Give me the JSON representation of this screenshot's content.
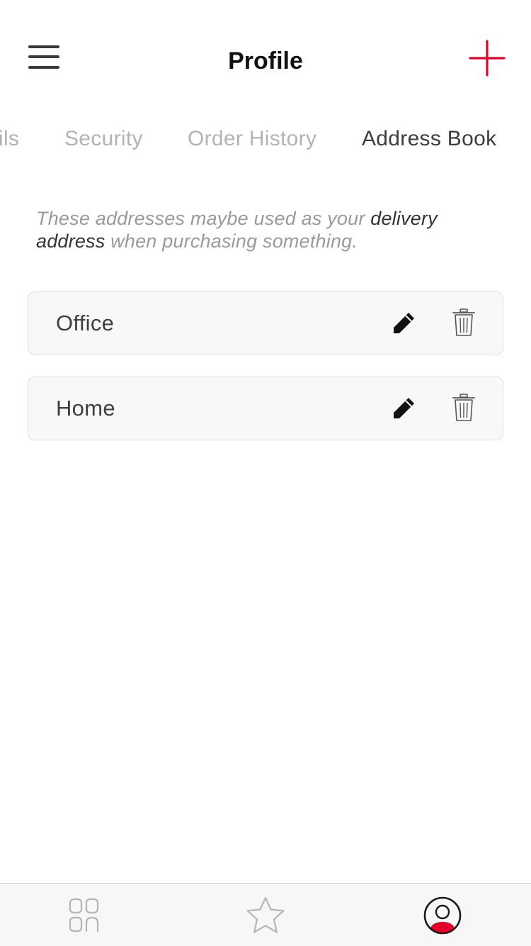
{
  "header": {
    "title": "Profile",
    "menu_icon": "hamburger-menu-icon",
    "add_icon": "plus-icon"
  },
  "tabs": [
    {
      "label": "Details",
      "visible_text": "ils",
      "active": false
    },
    {
      "label": "Security",
      "active": false
    },
    {
      "label": "Order History",
      "active": false
    },
    {
      "label": "Address Book",
      "active": true
    }
  ],
  "description": {
    "part1": "These addresses maybe used as your ",
    "emphasis": "delivery address",
    "part2": " when purchasing something."
  },
  "addresses": [
    {
      "label": "Office",
      "edit_icon": "pencil-icon",
      "delete_icon": "trash-icon"
    },
    {
      "label": "Home",
      "edit_icon": "pencil-icon",
      "delete_icon": "trash-icon"
    }
  ],
  "bottom_nav": [
    {
      "name": "dashboard",
      "icon": "grid-icon",
      "active": false
    },
    {
      "name": "favorites",
      "icon": "star-icon",
      "active": false
    },
    {
      "name": "profile",
      "icon": "user-profile-icon",
      "active": true
    }
  ],
  "colors": {
    "accent": "#e4002b",
    "text_dark": "#111111",
    "tab_inactive": "#b3b3b3",
    "tab_active": "#3d3d3d",
    "card_bg": "#f8f8f8",
    "card_border": "#dedede"
  }
}
